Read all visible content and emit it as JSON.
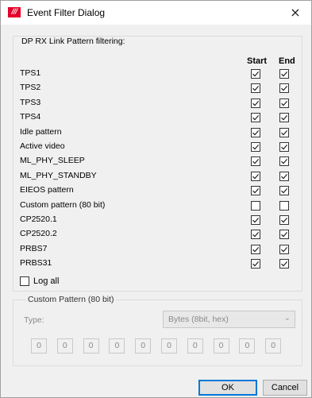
{
  "window": {
    "title": "Event Filter Dialog",
    "close_glyph": "×",
    "app_icon": "app-logo-icon",
    "app_icon_text": "///"
  },
  "link_pattern_group": {
    "title": "DP RX Link Pattern filtering:",
    "col_start": "Start",
    "col_end": "End",
    "rows": [
      {
        "label": "TPS1",
        "start": true,
        "end": true
      },
      {
        "label": "TPS2",
        "start": true,
        "end": true
      },
      {
        "label": "TPS3",
        "start": true,
        "end": true
      },
      {
        "label": "TPS4",
        "start": true,
        "end": true
      },
      {
        "label": "Idle pattern",
        "start": true,
        "end": true
      },
      {
        "label": "Active video",
        "start": true,
        "end": true
      },
      {
        "label": "ML_PHY_SLEEP",
        "start": true,
        "end": true
      },
      {
        "label": "ML_PHY_STANDBY",
        "start": true,
        "end": true
      },
      {
        "label": "EIEOS pattern",
        "start": true,
        "end": true
      },
      {
        "label": "Custom pattern (80 bit)",
        "start": false,
        "end": false
      },
      {
        "label": "CP2520.1",
        "start": true,
        "end": true
      },
      {
        "label": "CP2520.2",
        "start": true,
        "end": true
      },
      {
        "label": "PRBS7",
        "start": true,
        "end": true
      },
      {
        "label": "PRBS31",
        "start": true,
        "end": true
      }
    ],
    "log_all": {
      "label": "Log all",
      "checked": false
    }
  },
  "custom_pattern_group": {
    "title": "Custom Pattern (80 bit)",
    "type_label": "Type:",
    "type_value": "Bytes (8bit, hex)",
    "bytes": [
      "0",
      "0",
      "0",
      "0",
      "0",
      "0",
      "0",
      "0",
      "0",
      "0"
    ]
  },
  "buttons": {
    "ok": "OK",
    "cancel": "Cancel"
  },
  "colors": {
    "accent": "#0078d7",
    "brand": "#e3002b",
    "dialog_bg": "#f0f0f0"
  }
}
